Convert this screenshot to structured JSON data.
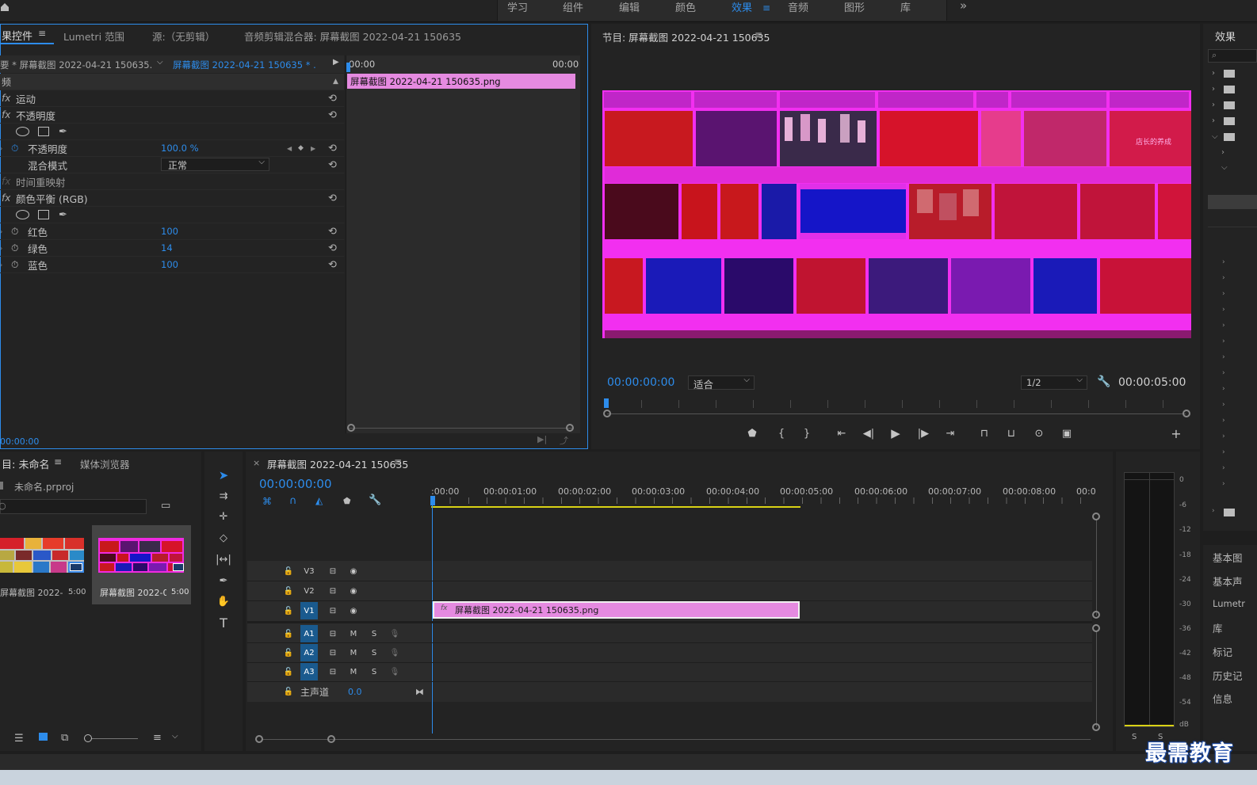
{
  "workspace_tabs": [
    "学习",
    "组件",
    "编辑",
    "颜色",
    "效果",
    "音频",
    "图形",
    "库"
  ],
  "workspace_active": "效果",
  "workspace_more": "»",
  "effect_controls": {
    "tabs": [
      "果控件",
      "Lumetri 范围",
      "源:（无剪辑）",
      "音频剪辑混合器: 屏幕截图 2022-04-21 150635"
    ],
    "master_label": "要 * 屏幕截图 2022-04-21 150635...",
    "clip_label": "屏幕截图 2022-04-21 150635 * ...",
    "ruler_start": "00:00",
    "ruler_end": "00:00",
    "clip_bar": "屏幕截图 2022-04-21  150635.png",
    "section_video": "频",
    "rows": {
      "motion": "运动",
      "opacity": "不透明度",
      "opacity_param": "不透明度",
      "opacity_value": "100.0 %",
      "blend_mode": "混合模式",
      "blend_value": "正常",
      "time_remap": "时间重映射",
      "color_balance": "颜色平衡 (RGB)",
      "red": "红色",
      "red_value": "100",
      "green": "绿色",
      "green_value": "14",
      "blue": "蓝色",
      "blue_value": "100"
    },
    "fx": "fx",
    "bottom_time": "00:00:00"
  },
  "program_monitor": {
    "title": "节目: 屏幕截图 2022-04-21 150635",
    "timecode": "00:00:00:00",
    "fit": "适合",
    "quality": "1/2",
    "duration": "00:00:05:00",
    "image_label": "店长的养成"
  },
  "project": {
    "tabs": [
      "目: 未命名",
      "媒体浏览器"
    ],
    "file": "未命名.prproj",
    "items": [
      {
        "name": "屏幕截图 2022-...",
        "duration": "5:00"
      },
      {
        "name": "屏幕截图 2022-0...",
        "duration": "5:00"
      }
    ]
  },
  "timeline": {
    "title": "屏幕截图 2022-04-21 150635",
    "timecode": "00:00:00:00",
    "ruler": [
      ":00:00",
      "00:00:01:00",
      "00:00:02:00",
      "00:00:03:00",
      "00:00:04:00",
      "00:00:05:00",
      "00:00:06:00",
      "00:00:07:00",
      "00:00:08:00",
      "00:0"
    ],
    "video_tracks": [
      "V3",
      "V2",
      "V1"
    ],
    "audio_tracks": [
      "A1",
      "A2",
      "A3"
    ],
    "master": "主声道",
    "master_value": "0.0",
    "m_label": "M",
    "s_label": "S",
    "clip": "屏幕截图 2022-04-21  150635.png"
  },
  "audio_meter": {
    "scale": [
      "0",
      "-6",
      "-12",
      "-18",
      "-24",
      "-30",
      "-36",
      "-42",
      "-48",
      "-54",
      "dB"
    ],
    "solo": [
      "S",
      "S"
    ]
  },
  "effects_panel": {
    "title": "效果",
    "items": [
      "基本图",
      "基本声",
      "Lumetr",
      "库",
      "标记",
      "历史记",
      "信息"
    ]
  },
  "watermark": "最需教育",
  "colors": {
    "accent": "#2d8ceb",
    "clip": "#e58ae0",
    "magenta": "#ff00ff",
    "playhead_yellow": "#d9d215"
  }
}
